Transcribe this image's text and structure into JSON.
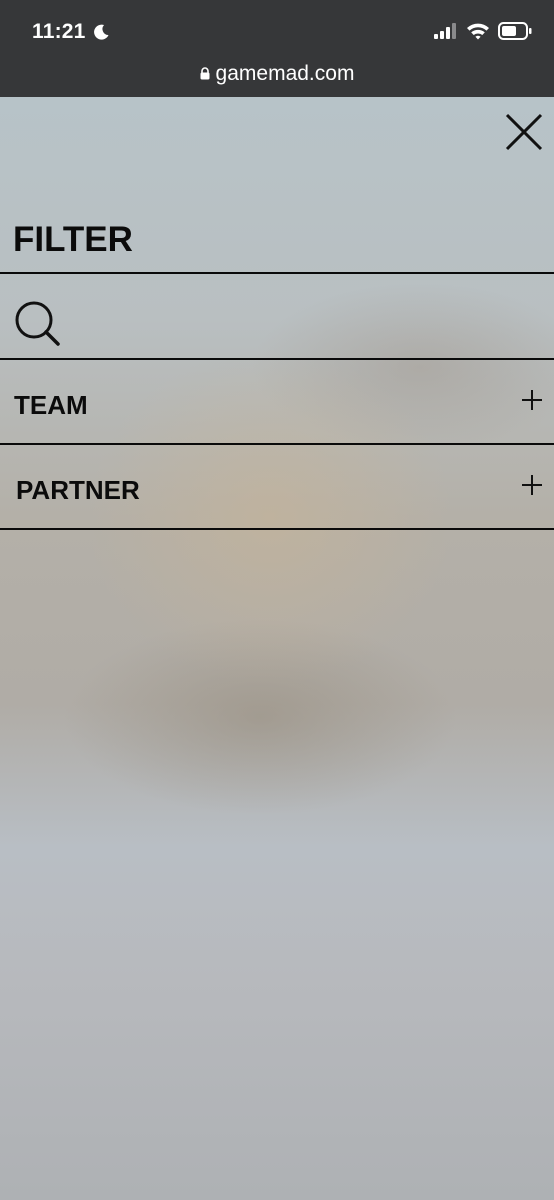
{
  "status_bar": {
    "time": "11:21",
    "url": "gamemad.com"
  },
  "filter": {
    "title": "FILTER",
    "search_placeholder": "",
    "sections": [
      {
        "label": "TEAM",
        "expand_icon": "plus-icon"
      },
      {
        "label": "PARTNER",
        "expand_icon": "plus-icon"
      }
    ]
  },
  "icons": {
    "close": "close-icon",
    "search": "search-icon",
    "lock": "lock-icon",
    "moon": "moon-icon",
    "signal": "signal-icon",
    "wifi": "wifi-icon",
    "battery": "battery-icon"
  },
  "colors": {
    "status_bar_bg": "#363739",
    "text": "#0b0b0b",
    "divider": "#0a0a0a"
  }
}
